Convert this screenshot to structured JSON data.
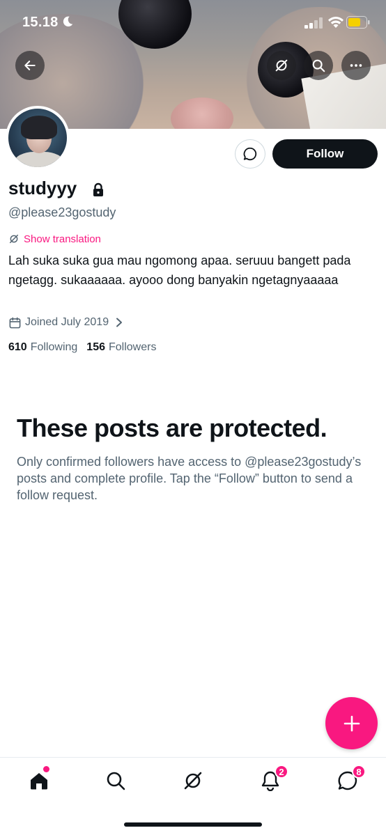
{
  "status_bar": {
    "time": "15.18",
    "icons": [
      "moon-icon",
      "cellular-signal-icon",
      "wifi-icon",
      "battery-icon"
    ],
    "battery_color": "#f5d000"
  },
  "header": {
    "back_icon": "arrow-left-icon",
    "grok_icon": "grok-icon",
    "search_icon": "search-icon",
    "more_icon": "more-horizontal-icon"
  },
  "profile": {
    "display_name": "studyyy",
    "handle": "@please23gostudy",
    "translate_label": "Show translation",
    "bio": "Lah suka suka gua mau ngomong apaa. seruuu bangett pada ngetagg. sukaaaaaa. ayooo dong banyakin ngetagnyaaaaa",
    "joined": "Joined July 2019",
    "following_count": "610",
    "following_label": "Following",
    "followers_count": "156",
    "followers_label": "Followers"
  },
  "actions": {
    "message_icon": "message-bubble-icon",
    "follow_label": "Follow"
  },
  "protected": {
    "title": "These posts are protected.",
    "body": "Only confirmed followers have access to @please23gostudy’s posts and complete profile. Tap the “Follow” button to send a follow request."
  },
  "bottom_nav": {
    "items": [
      "home-icon",
      "search-icon",
      "grok-icon",
      "notifications-icon",
      "messages-icon"
    ],
    "notifications_badge": "2",
    "messages_badge": "8"
  },
  "colors": {
    "accent": "#f91880",
    "text_primary": "#0f1419",
    "text_secondary": "#536471"
  }
}
